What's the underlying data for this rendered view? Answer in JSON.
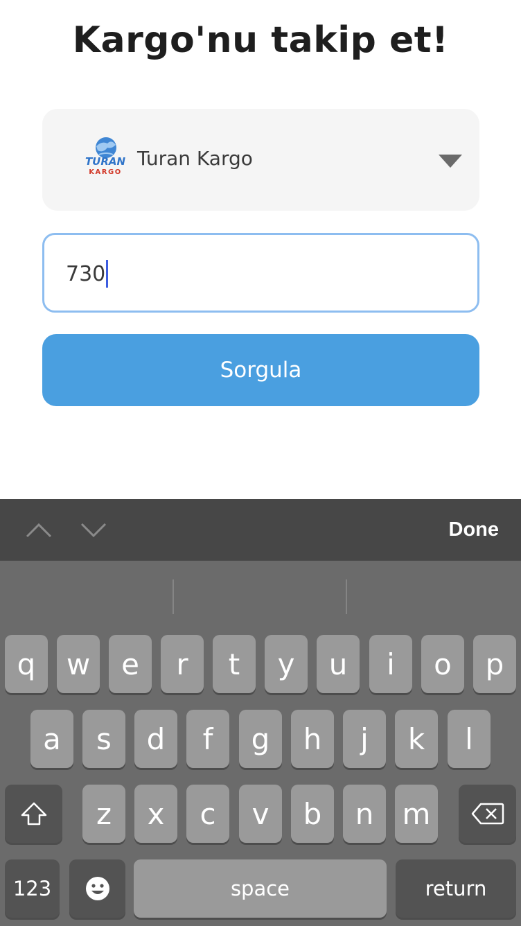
{
  "page": {
    "title": "Kargo'nu takip et!"
  },
  "carrier_select": {
    "selected_label": "Turan Kargo",
    "logo": {
      "name": "turan-kargo-logo",
      "text_top": "TURAN",
      "text_bottom": "KARGO"
    },
    "icon": "dropdown-triangle-icon"
  },
  "tracking_input": {
    "value": "730"
  },
  "query_button": {
    "label": "Sorgula"
  },
  "keyboard_toolbar": {
    "prev_icon": "chevron-up-icon",
    "next_icon": "chevron-down-icon",
    "done_label": "Done"
  },
  "keyboard": {
    "row1": [
      "q",
      "w",
      "e",
      "r",
      "t",
      "y",
      "u",
      "i",
      "o",
      "p"
    ],
    "row2": [
      "a",
      "s",
      "d",
      "f",
      "g",
      "h",
      "j",
      "k",
      "l"
    ],
    "row3": [
      "z",
      "x",
      "c",
      "v",
      "b",
      "n",
      "m"
    ],
    "shift_icon": "shift-icon",
    "delete_icon": "backspace-icon",
    "numbers_label": "123",
    "emoji_icon": "emoji-icon",
    "space_label": "space",
    "return_label": "return"
  },
  "colors": {
    "accent": "#4a9fe0",
    "input_border": "#8dbdf0",
    "cursor": "#3d5de0",
    "keyboard_bg": "#6b6b6b",
    "toolbar_bg": "#474747",
    "key_bg": "#9a9a9a",
    "function_key_bg": "#535353"
  }
}
